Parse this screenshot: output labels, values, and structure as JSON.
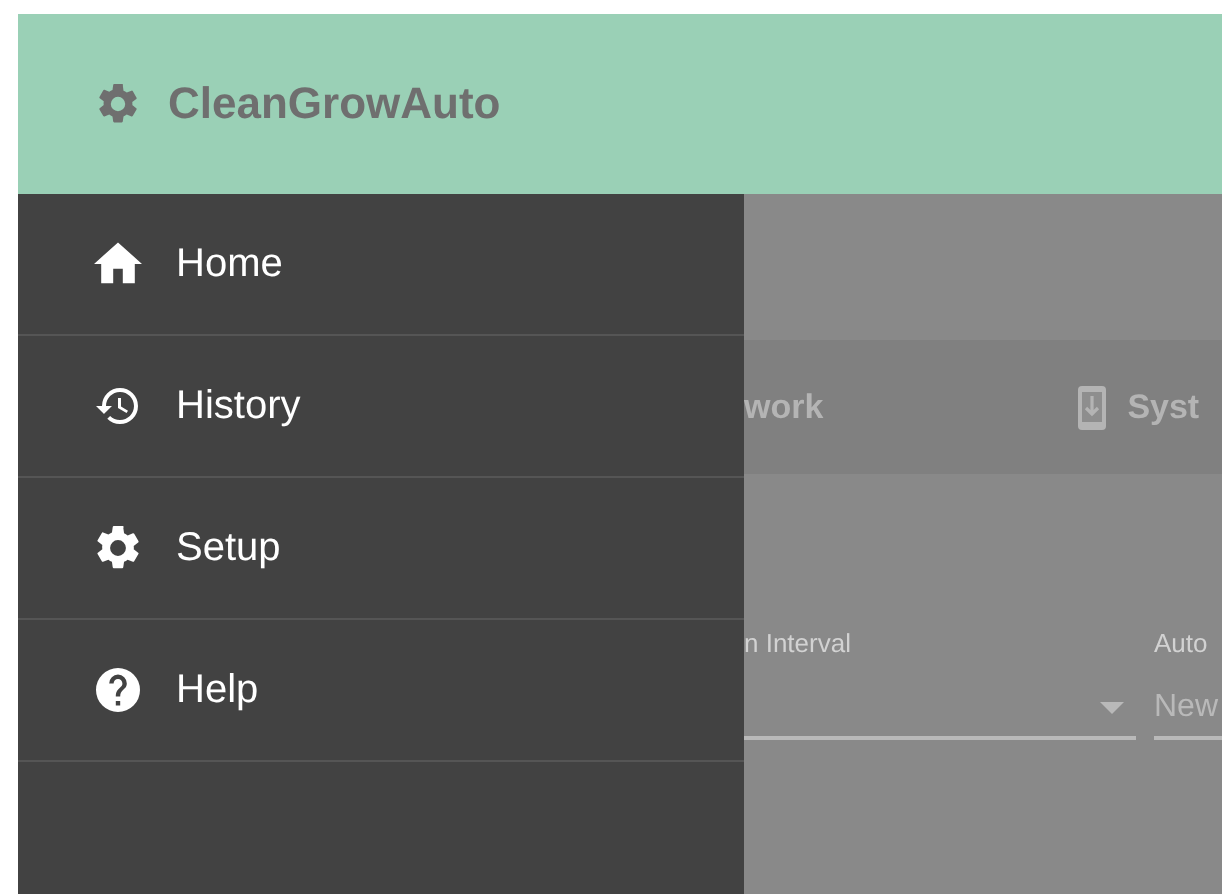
{
  "header": {
    "title": "CleanGrowAuto"
  },
  "drawer": {
    "items": [
      {
        "label": "Home",
        "kind": "home"
      },
      {
        "label": "History",
        "kind": "history"
      },
      {
        "label": "Setup",
        "kind": "setup"
      },
      {
        "label": "Help",
        "kind": "help"
      }
    ]
  },
  "background": {
    "tabs": [
      {
        "label": "work",
        "kind": "none"
      },
      {
        "label": "Syst",
        "kind": "system"
      }
    ],
    "fields": [
      {
        "label": "n Interval",
        "kind": "select"
      },
      {
        "label": "Auto",
        "value": "New",
        "kind": "text"
      }
    ]
  }
}
